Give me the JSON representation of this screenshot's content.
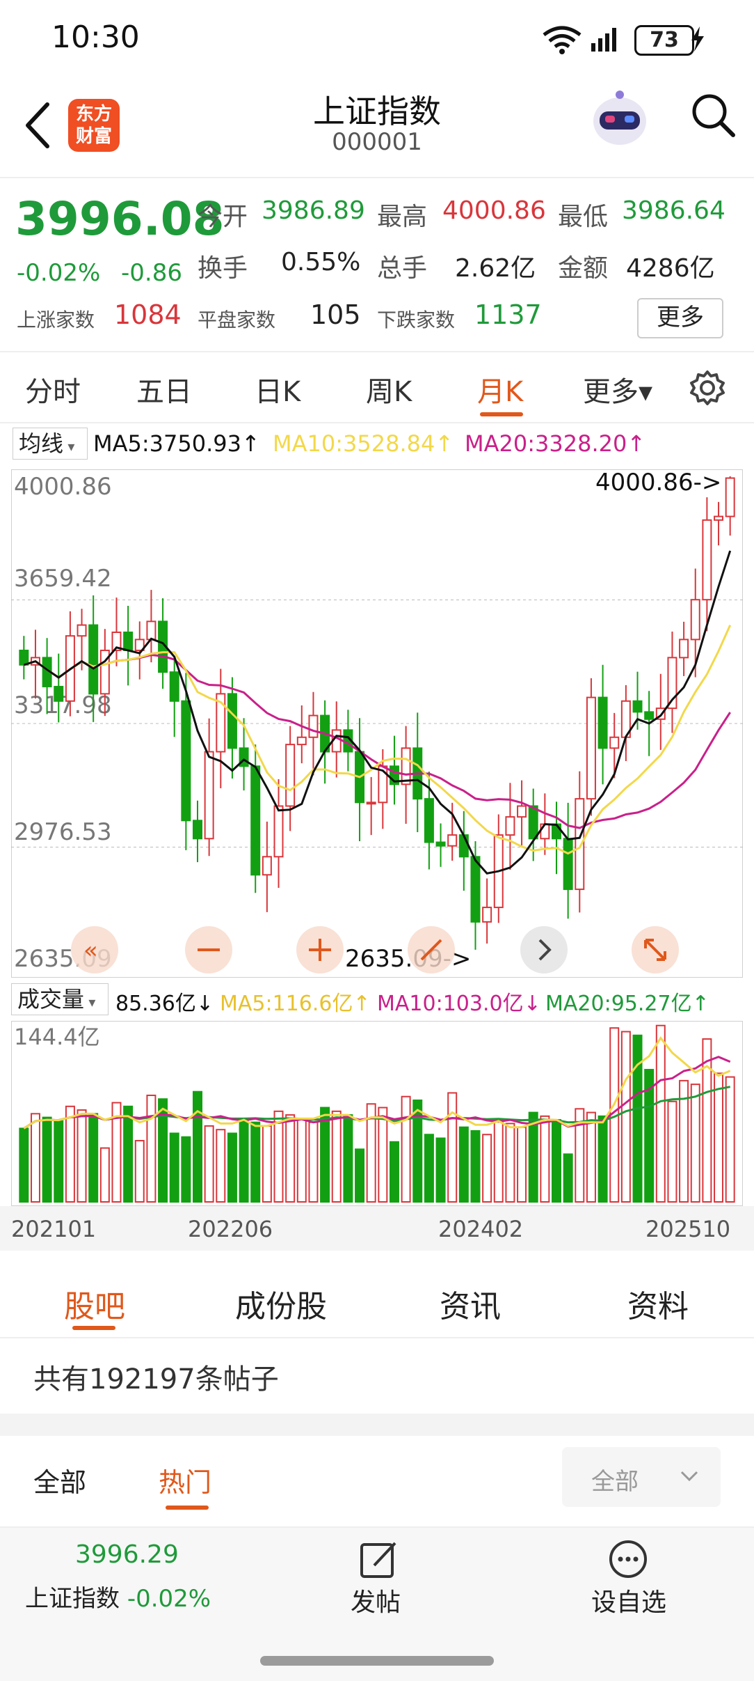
{
  "status_bar": {
    "time": "10:30",
    "battery": "73"
  },
  "header": {
    "logo_line1": "东方",
    "logo_line2": "财富",
    "title": "上证指数",
    "code": "000001"
  },
  "quote": {
    "price": "3996.08",
    "change_pct": "-0.02%",
    "change": "-0.86",
    "open_label": "今开",
    "open": "3986.89",
    "high_label": "最高",
    "high": "4000.86",
    "low_label": "最低",
    "low": "3986.64",
    "turnover_label": "换手",
    "turnover": "0.55%",
    "volume_label": "总手",
    "volume": "2.62亿",
    "amount_label": "金额",
    "amount": "4286亿",
    "up_label": "上涨家数",
    "up_count": "1084",
    "flat_label": "平盘家数",
    "flat_count": "105",
    "down_label": "下跌家数",
    "down_count": "1137",
    "more": "更多"
  },
  "period_tabs": [
    "分时",
    "五日",
    "日K",
    "周K",
    "月K",
    "更多▾"
  ],
  "active_period": "月K",
  "ma_bar": {
    "select": "均线",
    "ma5": "MA5:3750.93",
    "ma10": "MA10:3528.84",
    "ma20": "MA20:3328.20"
  },
  "kline": {
    "y_labels": [
      "4000.86",
      "3659.42",
      "3317.98",
      "2976.53",
      "2635.09"
    ],
    "max_annotation": "4000.86->",
    "min_annotation": "2635.09->"
  },
  "volume_bar": {
    "select": "成交量",
    "value": "85.36亿",
    "ma5": "MA5:116.6亿",
    "ma10": "MA10:103.0亿",
    "ma20": "MA20:95.27亿",
    "max_label": "144.4亿"
  },
  "x_labels": [
    "202101",
    "202206",
    "202402",
    "202510"
  ],
  "colors": {
    "up": "#d8363b",
    "down": "#12a012",
    "ma5": "#111111",
    "ma10": "#f2d84a",
    "ma20": "#c9208a",
    "accent": "#e0581b"
  },
  "chart_data": [
    {
      "type": "candlestick",
      "title": "",
      "ylim": [
        2635.09,
        4000.86
      ],
      "x_range": [
        "202101",
        "202510"
      ],
      "last_close": 3996.08,
      "max": 4000.86,
      "min": 2635.09,
      "closes": [
        3480,
        3500,
        3420,
        3380,
        3560,
        3590,
        3400,
        3520,
        3570,
        3520,
        3550,
        3600,
        3460,
        3380,
        3050,
        3000,
        3240,
        3400,
        3250,
        3200,
        2900,
        2950,
        3090,
        3260,
        3280,
        3340,
        3240,
        3300,
        3240,
        3100,
        3100,
        3200,
        3150,
        3250,
        3110,
        2990,
        2980,
        3010,
        2950,
        2770,
        2810,
        3010,
        3060,
        3090,
        3000,
        3040,
        3000,
        2860,
        3110,
        3390,
        3250,
        3280,
        3380,
        3350,
        3330,
        3360,
        3500,
        3550,
        3660,
        3880,
        3890,
        3996
      ]
    },
    {
      "type": "bar",
      "title": "",
      "ylim": [
        0,
        144.4
      ],
      "last_value": 85.36
    }
  ]
}
